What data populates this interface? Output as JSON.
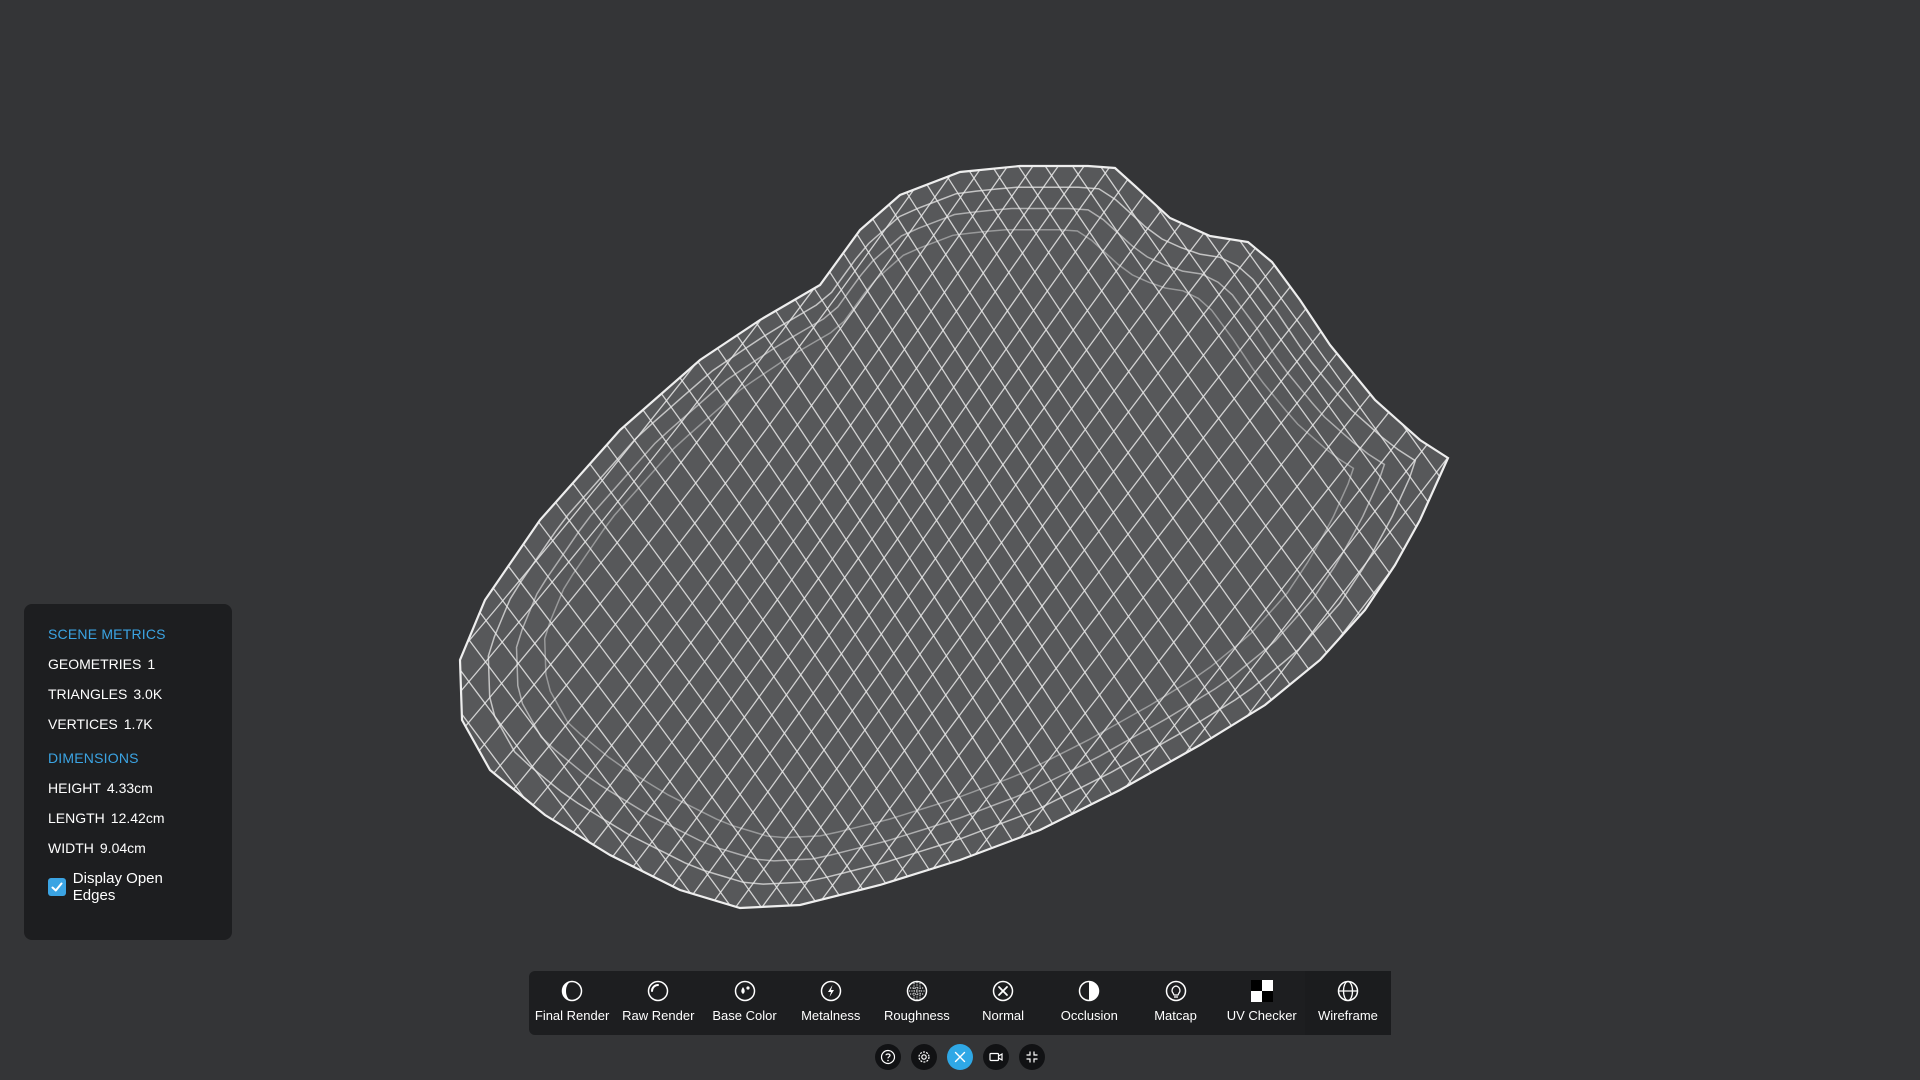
{
  "metrics": {
    "scene_title": "SCENE METRICS",
    "geometries_label": "GEOMETRIES",
    "geometries_value": "1",
    "triangles_label": "TRIANGLES",
    "triangles_value": "3.0K",
    "vertices_label": "VERTICES",
    "vertices_value": "1.7K",
    "dimensions_title": "DIMENSIONS",
    "height_label": "HEIGHT",
    "height_value": "4.33cm",
    "length_label": "LENGTH",
    "length_value": "12.42cm",
    "width_label": "WIDTH",
    "width_value": "9.04cm",
    "open_edges_label": "Display Open Edges",
    "open_edges_checked": true
  },
  "toolbar": {
    "active": "Wireframe",
    "items": [
      {
        "label": "Final Render",
        "icon": "final-render-icon"
      },
      {
        "label": "Raw Render",
        "icon": "raw-render-icon"
      },
      {
        "label": "Base Color",
        "icon": "base-color-icon"
      },
      {
        "label": "Metalness",
        "icon": "metalness-icon"
      },
      {
        "label": "Roughness",
        "icon": "roughness-icon"
      },
      {
        "label": "Normal",
        "icon": "normal-icon"
      },
      {
        "label": "Occlusion",
        "icon": "occlusion-icon"
      },
      {
        "label": "Matcap",
        "icon": "matcap-icon"
      },
      {
        "label": "UV Checker",
        "icon": "uv-checker-icon"
      },
      {
        "label": "Wireframe",
        "icon": "wireframe-icon"
      }
    ]
  },
  "controls": [
    {
      "icon": "help-icon"
    },
    {
      "icon": "settings-icon"
    },
    {
      "icon": "close-icon",
      "active": true
    },
    {
      "icon": "camera-icon"
    },
    {
      "icon": "exit-fullscreen-icon"
    }
  ],
  "colors": {
    "background": "#343537",
    "panel": "#1d1e20",
    "accent": "#3ba4e3",
    "mesh_fill": "#57585a",
    "mesh_wire": "#e8e8e8"
  }
}
